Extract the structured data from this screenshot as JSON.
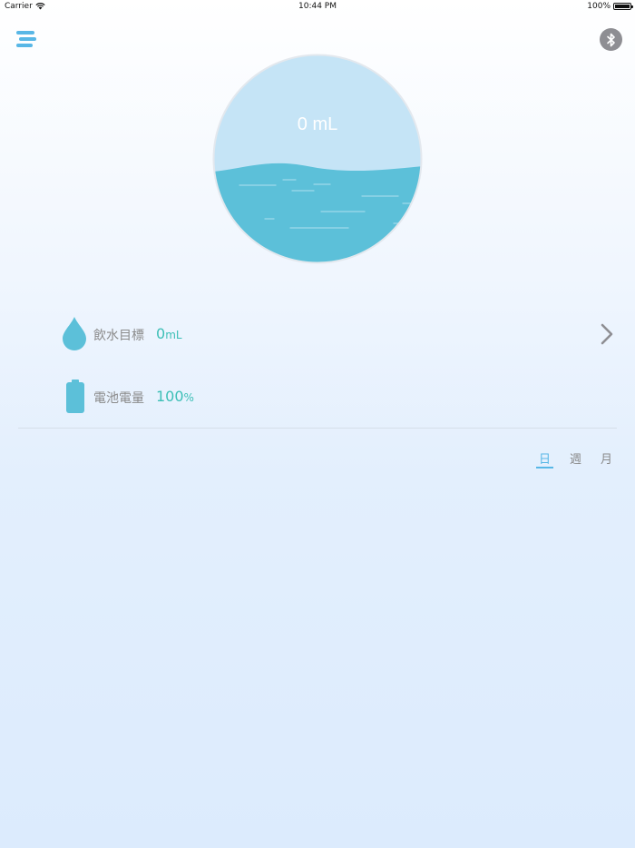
{
  "status_bar": {
    "carrier": "Carrier",
    "time": "10:44 PM",
    "battery": "100%",
    "battery_level": 1.0
  },
  "header": {
    "menu_icon": "hamburger-menu-icon",
    "bluetooth_icon": "bluetooth-icon"
  },
  "water_gauge": {
    "amount": "0 mL",
    "water_color": "#5cc0d9",
    "sky_color": "#c5e4f6"
  },
  "goal": {
    "label": "飲水目標",
    "value": "0",
    "unit": "mL",
    "icon": "water-drop-icon"
  },
  "battery_info": {
    "label": "電池電量",
    "value": "100",
    "unit": "%",
    "icon": "battery-icon"
  },
  "period_tabs": [
    {
      "label": "日",
      "active": true
    },
    {
      "label": "週",
      "active": false
    },
    {
      "label": "月",
      "active": false
    }
  ],
  "colors": {
    "accent": "#58b7e6",
    "value_text": "#3cbfb6",
    "label_text": "#8a8a8a"
  }
}
